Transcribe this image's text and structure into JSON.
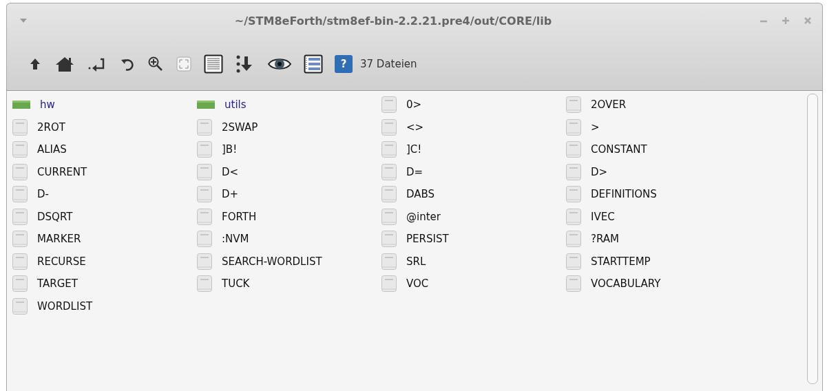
{
  "window": {
    "title": "~/STM8eForth/stm8ef-bin-2.2.21.pre4/out/CORE/lib"
  },
  "toolbar": {
    "help_glyph": "?",
    "status": "37 Dateien"
  },
  "files": [
    {
      "name": "hw",
      "kind": "folder"
    },
    {
      "name": "utils",
      "kind": "folder"
    },
    {
      "name": "0>",
      "kind": "file"
    },
    {
      "name": "2OVER",
      "kind": "file"
    },
    {
      "name": "2ROT",
      "kind": "file"
    },
    {
      "name": "2SWAP",
      "kind": "file"
    },
    {
      "name": "<>",
      "kind": "file"
    },
    {
      "name": ">",
      "kind": "file"
    },
    {
      "name": "ALIAS",
      "kind": "file"
    },
    {
      "name": "]B!",
      "kind": "file"
    },
    {
      "name": "]C!",
      "kind": "file"
    },
    {
      "name": "CONSTANT",
      "kind": "file"
    },
    {
      "name": "CURRENT",
      "kind": "file"
    },
    {
      "name": "D<",
      "kind": "file"
    },
    {
      "name": "D=",
      "kind": "file"
    },
    {
      "name": "D>",
      "kind": "file"
    },
    {
      "name": "D-",
      "kind": "file"
    },
    {
      "name": "D+",
      "kind": "file"
    },
    {
      "name": "DABS",
      "kind": "file"
    },
    {
      "name": "DEFINITIONS",
      "kind": "file"
    },
    {
      "name": "DSQRT",
      "kind": "file"
    },
    {
      "name": "FORTH",
      "kind": "file"
    },
    {
      "name": "@inter",
      "kind": "file"
    },
    {
      "name": "IVEC",
      "kind": "file"
    },
    {
      "name": "MARKER",
      "kind": "file"
    },
    {
      "name": ":NVM",
      "kind": "file"
    },
    {
      "name": "PERSIST",
      "kind": "file"
    },
    {
      "name": "?RAM",
      "kind": "file"
    },
    {
      "name": "RECURSE",
      "kind": "file"
    },
    {
      "name": "SEARCH-WORDLIST",
      "kind": "file"
    },
    {
      "name": "SRL",
      "kind": "file"
    },
    {
      "name": "STARTTEMP",
      "kind": "file"
    },
    {
      "name": "TARGET",
      "kind": "file"
    },
    {
      "name": "TUCK",
      "kind": "file"
    },
    {
      "name": "VOC",
      "kind": "file"
    },
    {
      "name": "VOCABULARY",
      "kind": "file"
    },
    {
      "name": "WORDLIST",
      "kind": "file"
    }
  ]
}
